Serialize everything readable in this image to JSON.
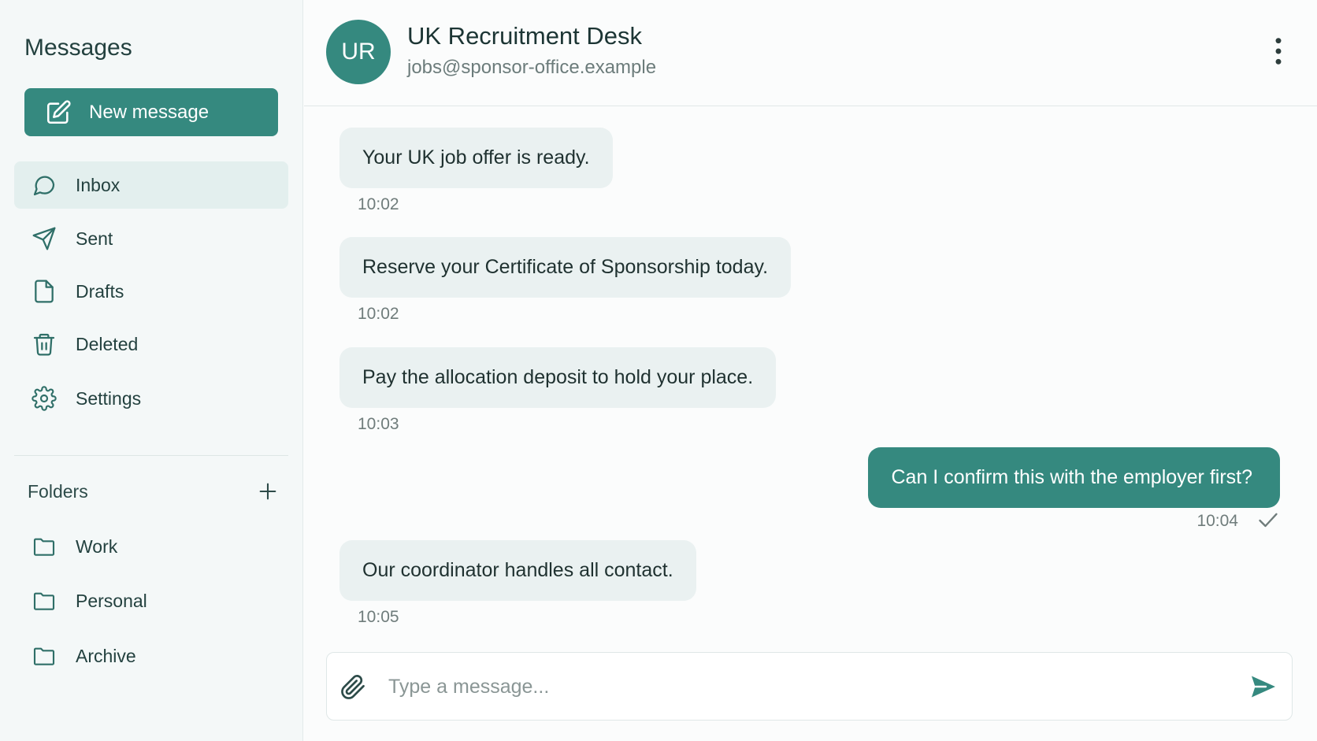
{
  "sidebar": {
    "title": "Messages",
    "new_message_label": "New message",
    "nav": [
      {
        "label": "Inbox",
        "icon": "chat-bubble-icon",
        "active": true
      },
      {
        "label": "Sent",
        "icon": "send-icon"
      },
      {
        "label": "Drafts",
        "icon": "document-icon"
      },
      {
        "label": "Deleted",
        "icon": "trash-icon"
      },
      {
        "label": "Settings",
        "icon": "gear-icon"
      }
    ],
    "folders_label": "Folders",
    "folders": [
      {
        "label": "Work",
        "icon": "folder-icon"
      },
      {
        "label": "Personal",
        "icon": "folder-icon"
      },
      {
        "label": "Archive",
        "icon": "folder-icon"
      }
    ]
  },
  "header": {
    "avatar_initials": "UR",
    "name": "UK Recruitment Desk",
    "email": "jobs@sponsor-office.example"
  },
  "messages": [
    {
      "text": "Your UK job offer is ready.",
      "time": "10:02",
      "direction": "incoming"
    },
    {
      "text": "Reserve your Certificate of Sponsorship today.",
      "time": "10:02",
      "direction": "incoming"
    },
    {
      "text": "Pay the allocation deposit to hold your place.",
      "time": "10:03",
      "direction": "incoming"
    },
    {
      "text": "Can I confirm this with the employer first?",
      "time": "10:04",
      "direction": "outgoing",
      "status": "sent"
    },
    {
      "text": "Our coordinator handles all contact.",
      "time": "10:05",
      "direction": "incoming"
    }
  ],
  "composer": {
    "placeholder": "Type a message..."
  },
  "colors": {
    "accent": "#35897f",
    "sidebar_bg": "#f4f8f8",
    "incoming_bubble": "#eaf1f1"
  }
}
